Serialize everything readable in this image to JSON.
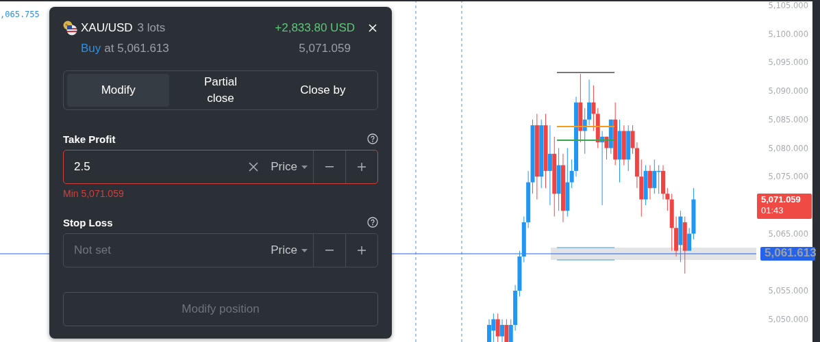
{
  "left_label": ",065.755",
  "position": {
    "symbol": "XAU/USD",
    "lots": "3 lots",
    "pnl": "+2,833.80 USD",
    "side": "Buy",
    "entry": "at 5,061.613",
    "current": "5,071.059"
  },
  "tabs": [
    {
      "label": "Modify",
      "selected": true
    },
    {
      "label": "Partial close",
      "selected": false
    },
    {
      "label": "Close by",
      "selected": false
    }
  ],
  "take_profit": {
    "label": "Take Profit",
    "value": "2.5",
    "mode": "Price",
    "error": "Min 5,071.059",
    "invalid": true
  },
  "stop_loss": {
    "label": "Stop Loss",
    "placeholder": "Not set",
    "mode": "Price",
    "invalid": false
  },
  "submit": {
    "label": "Modify position",
    "disabled": true
  },
  "price_axis": {
    "labels": [
      "5,105.000",
      "5,100.000",
      "5,095.000",
      "5,090.000",
      "5,085.000",
      "5,080.000",
      "5,075.000",
      "5,065.000",
      "5,055.000",
      "5,050.000"
    ]
  },
  "price_tags": [
    {
      "kind": "last",
      "price": "5,071.059",
      "countdown": "01:43"
    },
    {
      "kind": "entry",
      "price": "5,061.613"
    }
  ]
}
